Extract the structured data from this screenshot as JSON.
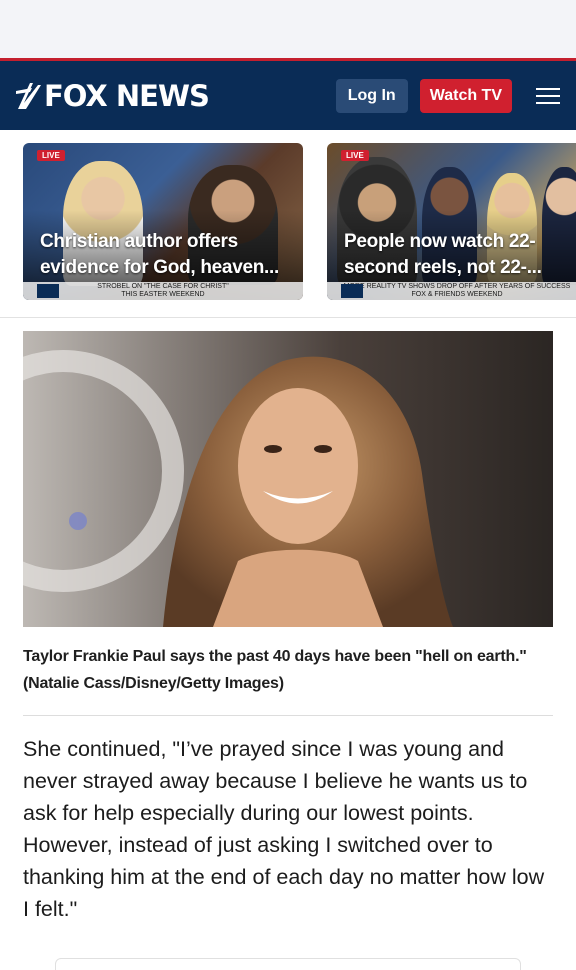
{
  "header": {
    "logo_text": "FOX NEWS",
    "login_label": "Log In",
    "watch_label": "Watch TV",
    "colors": {
      "navy": "#0a2c56",
      "red": "#d0202f"
    }
  },
  "promos": [
    {
      "live_label": "LIVE",
      "headline": "Christian author offers evidence for God, heaven...",
      "chyron_line1": "STROBEL ON \"THE CASE FOR CHRIST\"",
      "chyron_line2": "THIS EASTER WEEKEND"
    },
    {
      "live_label": "LIVE",
      "headline": "People now watch 22-second reels, not 22-...",
      "chyron_line1": "MORE REALITY TV SHOWS DROP OFF AFTER YEARS OF SUCCESS",
      "chyron_line2": "FOX & FRIENDS WEEKEND"
    }
  ],
  "article": {
    "caption": "Taylor Frankie Paul says the past 40 days have been \"hell on earth.\" (Natalie Cass/Disney/Getty Images)",
    "paragraph": "She continued, \"I’ve prayed since I was young and never strayed away because I believe he wants us to ask for help especially during our lowest points. However, instead of just asking I switched over to thanking him at the end of each day no matter how low I felt.\""
  }
}
